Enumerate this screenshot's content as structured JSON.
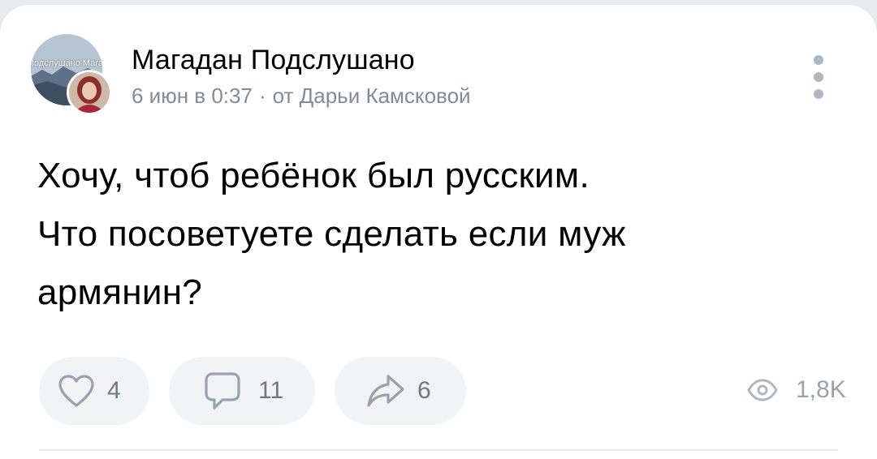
{
  "post": {
    "author": "Магадан Подслушано",
    "avatar_text": "Подслушано Магадан",
    "date": "6 июн в 0:37",
    "separator": "·",
    "by_line": "от Дарьи Камсковой",
    "text_lines": [
      "Хочу, чтоб ребёнок был русским.",
      "Что посоветуете сделать если муж",
      "армянин?"
    ]
  },
  "actions": {
    "likes": "4",
    "comments": "11",
    "shares": "6",
    "views": "1,8K"
  },
  "icons": {
    "like": "heart-icon",
    "comment": "comment-icon",
    "share": "share-arrow-icon",
    "views": "eye-icon",
    "more": "more-vertical-icon"
  },
  "colors": {
    "background": "#ffffff",
    "page": "#e8eaed",
    "secondary_text": "#818c99",
    "icon": "#99a2ad",
    "button_bg": "#f1f3f5"
  }
}
